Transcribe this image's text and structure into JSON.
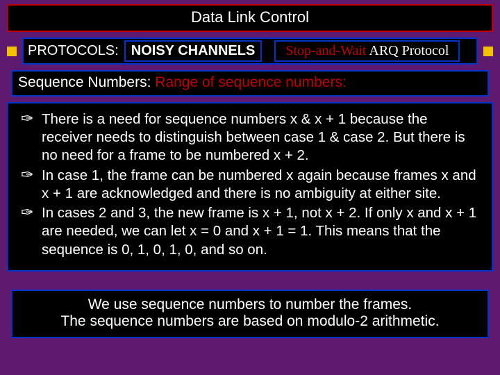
{
  "title": "Data Link Control",
  "row2": {
    "protocols_label": "PROTOCOLS:",
    "noisy_label": "NOISY CHANNELS",
    "stopwait_a": "Stop-and-Wait ",
    "stopwait_b": "ARQ Protocol"
  },
  "subtitle": {
    "a": "Sequence Numbers: ",
    "b": "Range of sequence numbers:"
  },
  "bullets": [
    "There is a need for sequence numbers x & x + 1 because the receiver needs to distinguish between case 1 & case 2. But there is no need for a frame to be numbered x + 2.",
    "In case 1, the frame can be numbered x again because frames x and x + 1 are acknowledged and there is no ambiguity at either site.",
    "In cases 2 and 3, the new frame is x + 1, not x + 2. If only x and x + 1 are needed, we can let x = 0 and x + 1 = 1. This means that the sequence is 0, 1, 0, 1, 0, and so on."
  ],
  "footer": {
    "line1": "We use sequence numbers to number the frames.",
    "line2": "The sequence numbers are based on modulo-2 arithmetic."
  },
  "glyphs": {
    "bullet": "✑"
  }
}
